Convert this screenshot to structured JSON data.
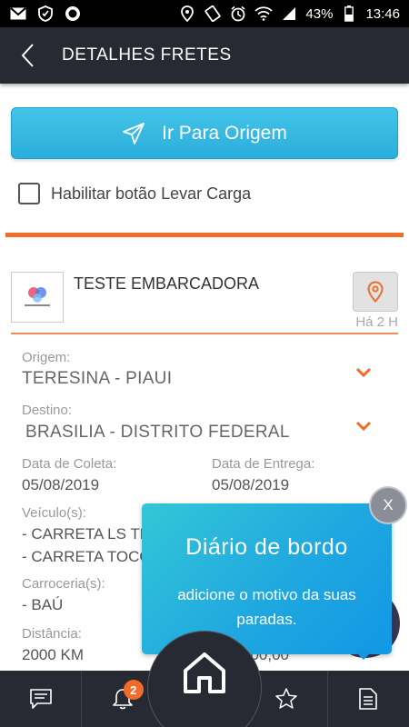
{
  "status_bar": {
    "battery": "43%",
    "time": "13:46"
  },
  "header": {
    "title": "DETALHES FRETES"
  },
  "actions": {
    "go_button_label": "Ir Para Origem",
    "checkbox_label": "Habilitar botão Levar Carga",
    "checkbox_checked": false
  },
  "company": {
    "name": "TESTE EMBARCADORA",
    "time_ago": "Há 2 H"
  },
  "details": {
    "origem_label": "Origem:",
    "origem_value": "TERESINA - PIAUI",
    "destino_label": "Destino:",
    "destino_value": "BRASILIA - DISTRITO FEDERAL",
    "coleta_label": "Data de Coleta:",
    "coleta_value": "05/08/2019",
    "entrega_label": "Data de Entrega:",
    "entrega_value": "05/08/2019",
    "veiculo_label": "Veículo(s):",
    "veiculo_1": "- CARRETA LS TR",
    "veiculo_2": "- CARRETA TOCO",
    "carroceria_label": "Carroceria(s):",
    "carroceria_value": "- BAÚ",
    "distancia_label": "Distância:",
    "distancia_value": "2000 KM",
    "valor_partial": "000,00"
  },
  "tooltip": {
    "title": "Diário de bordo",
    "text": "adicione o motivo da suas paradas.",
    "close_label": "X"
  },
  "bottom_nav": {
    "notification_count": "2"
  },
  "colors": {
    "accent_orange": "#f26b2b",
    "button_blue": "#2aaedb",
    "dark_bar": "#272a33"
  }
}
